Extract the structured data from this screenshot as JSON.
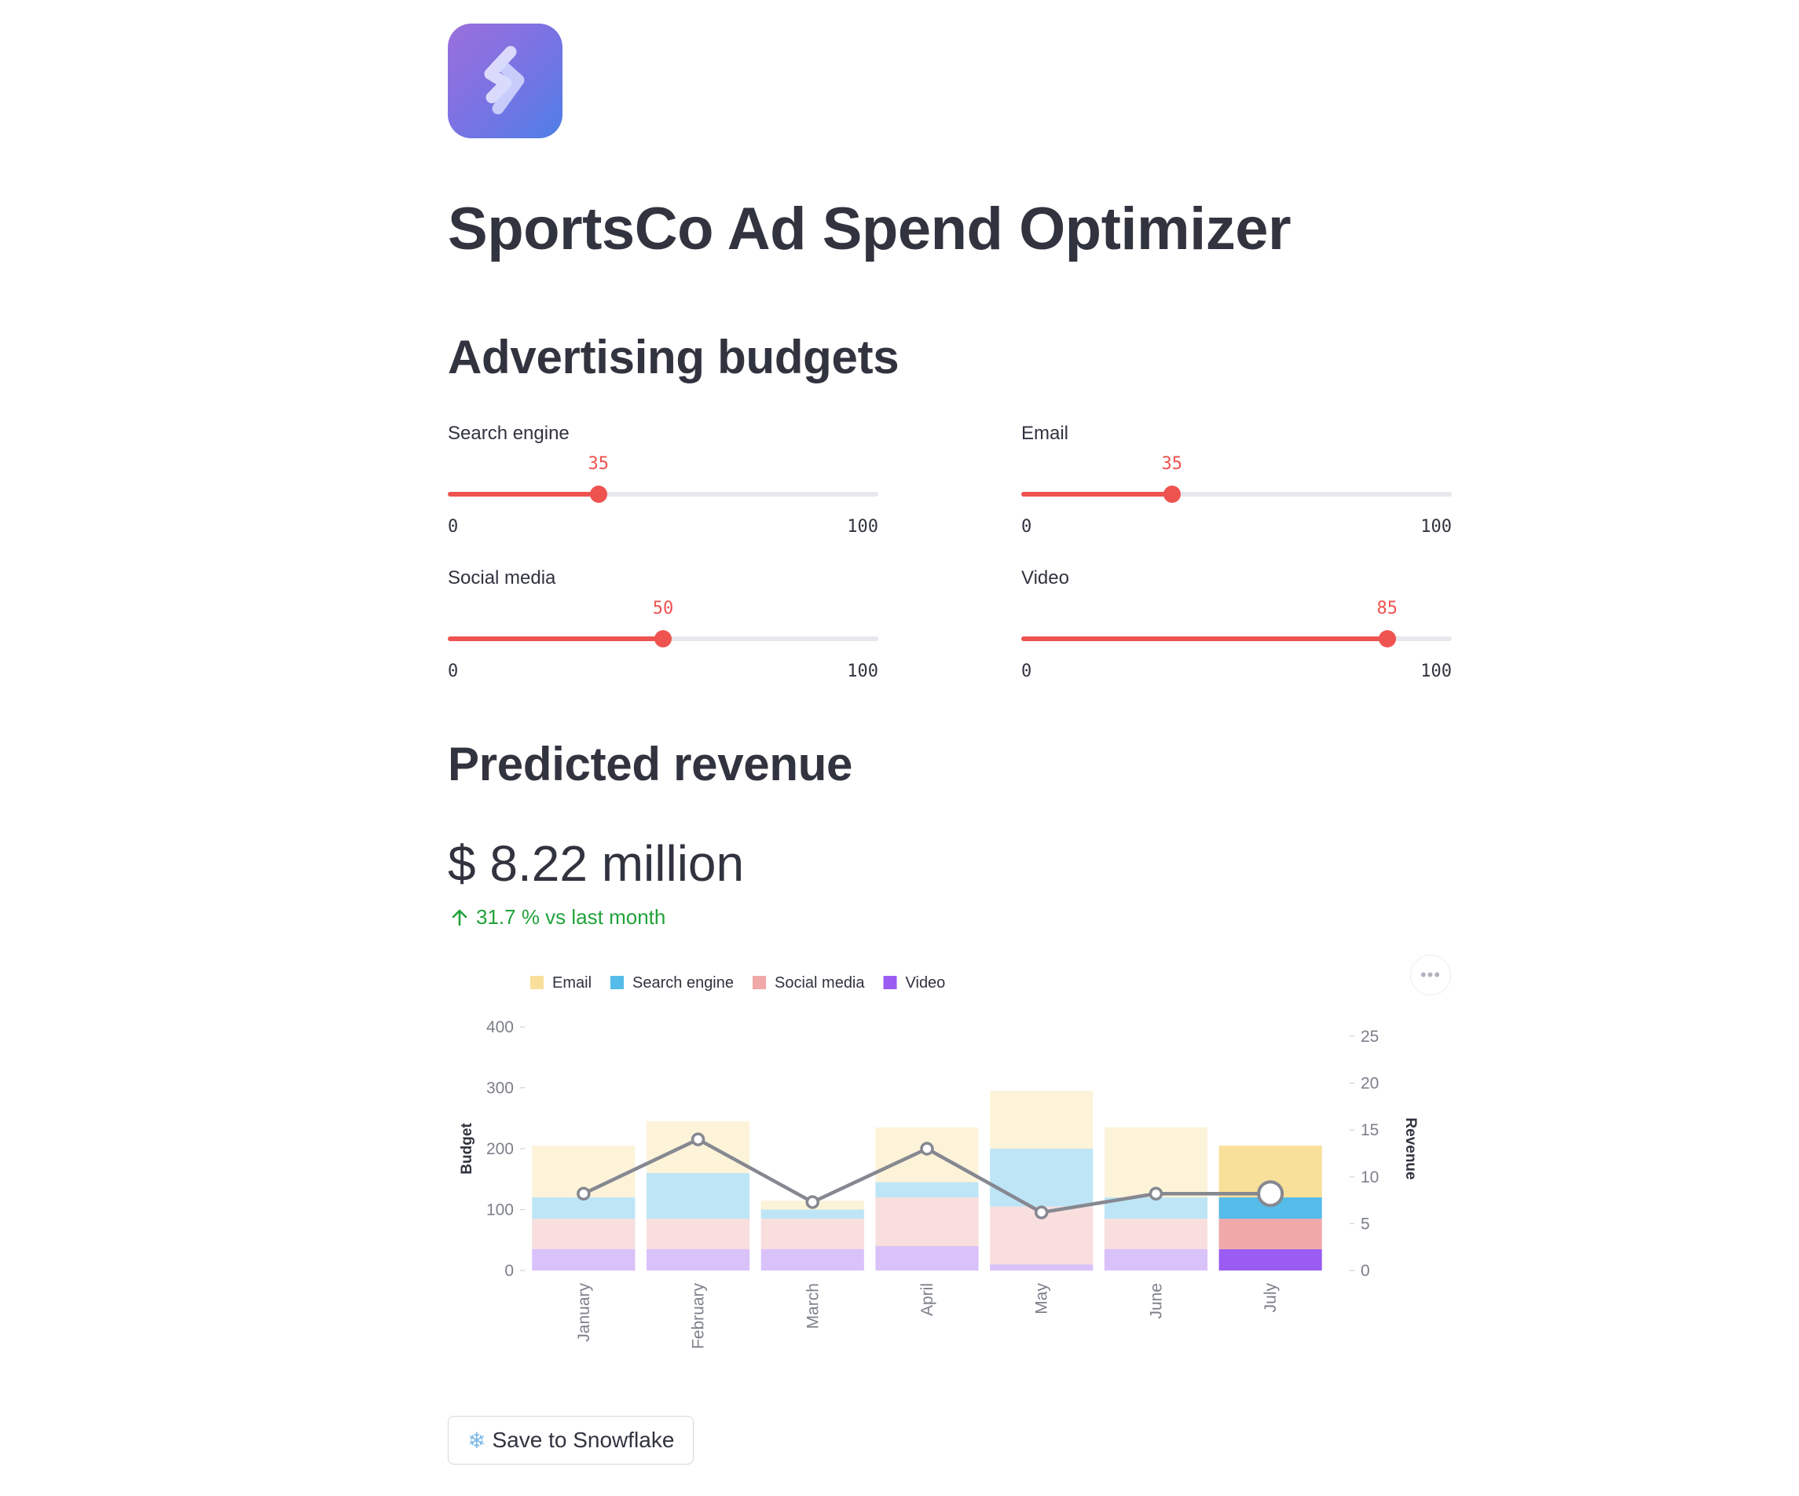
{
  "app": {
    "title": "SportsCo Ad Spend Optimizer",
    "logo_icon": "snowflake-s-logo"
  },
  "budgets": {
    "heading": "Advertising budgets",
    "sliders": [
      {
        "label": "Search engine",
        "value": 35,
        "min": 0,
        "max": 100
      },
      {
        "label": "Email",
        "value": 35,
        "min": 0,
        "max": 100
      },
      {
        "label": "Social media",
        "value": 50,
        "min": 0,
        "max": 100
      },
      {
        "label": "Video",
        "value": 85,
        "min": 0,
        "max": 100
      }
    ],
    "accent_color": "#ef5350"
  },
  "revenue": {
    "heading": "Predicted revenue",
    "metric_value": "$ 8.22 million",
    "delta_text": "31.7 % vs last month",
    "delta_color": "#21a23a"
  },
  "chart_data": {
    "type": "bar",
    "stacked": true,
    "categories": [
      "January",
      "February",
      "March",
      "April",
      "May",
      "June",
      "July"
    ],
    "series": [
      {
        "name": "Video",
        "values": [
          35,
          35,
          35,
          40,
          10,
          35,
          35
        ],
        "color": "#9a5cf2"
      },
      {
        "name": "Social media",
        "values": [
          50,
          50,
          50,
          80,
          95,
          50,
          50
        ],
        "color": "#f0a8a8"
      },
      {
        "name": "Search engine",
        "values": [
          35,
          75,
          15,
          25,
          95,
          35,
          35
        ],
        "color": "#55bbe8"
      },
      {
        "name": "Email",
        "values": [
          85,
          85,
          15,
          90,
          95,
          115,
          85
        ],
        "color": "#f8e09a"
      }
    ],
    "legend_order": [
      "Email",
      "Search engine",
      "Social media",
      "Video"
    ],
    "line": {
      "axis": "right",
      "values": [
        8.2,
        14,
        7.3,
        13,
        6.2,
        8.2,
        8.2
      ]
    },
    "ylabel": "Budget",
    "ylim": [
      0,
      400
    ],
    "yticks": [
      0,
      100,
      200,
      300,
      400
    ],
    "y2label": "Revenue",
    "y2lim": [
      0,
      26
    ],
    "y2ticks": [
      0,
      5,
      10,
      15,
      20,
      25
    ],
    "highlight_index": 6,
    "legend_placement": "top-left"
  },
  "actions": {
    "save_label": "Save to Snowflake",
    "save_icon": "snowflake-icon"
  }
}
